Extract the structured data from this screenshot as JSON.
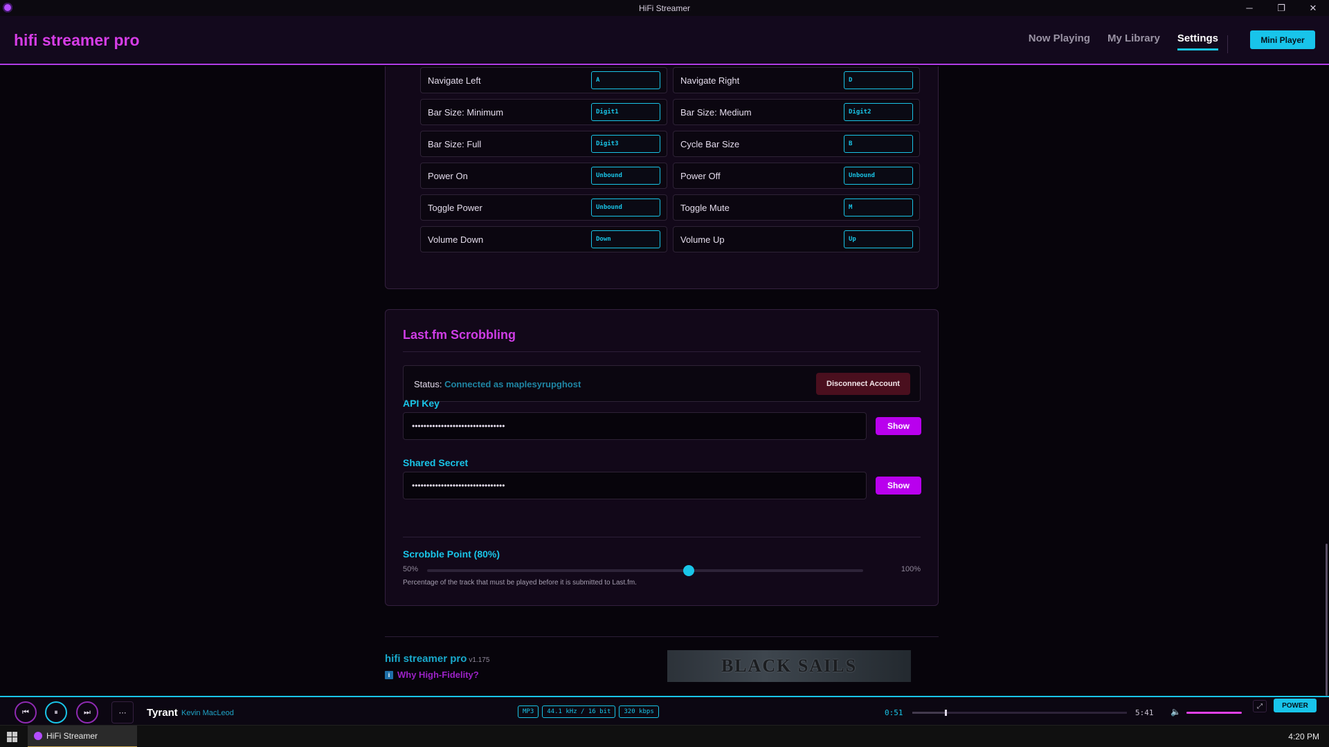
{
  "window": {
    "title": "HiFi Streamer",
    "controls": [
      "─",
      "❐",
      "✕"
    ]
  },
  "header": {
    "brand": "hifi streamer pro",
    "nav": [
      "Now Playing",
      "My Library",
      "Settings"
    ],
    "active_nav": "Settings",
    "mini_player": "Mini Player"
  },
  "keybindings": [
    {
      "label": "Navigate Left",
      "key": "A"
    },
    {
      "label": "Navigate Right",
      "key": "D"
    },
    {
      "label": "Bar Size: Minimum",
      "key": "Digit1"
    },
    {
      "label": "Bar Size: Medium",
      "key": "Digit2"
    },
    {
      "label": "Bar Size: Full",
      "key": "Digit3"
    },
    {
      "label": "Cycle Bar Size",
      "key": "B"
    },
    {
      "label": "Power On",
      "key": "Unbound"
    },
    {
      "label": "Power Off",
      "key": "Unbound"
    },
    {
      "label": "Toggle Power",
      "key": "Unbound"
    },
    {
      "label": "Toggle Mute",
      "key": "M"
    },
    {
      "label": "Volume Down",
      "key": "Down"
    },
    {
      "label": "Volume Up",
      "key": "Up"
    }
  ],
  "lastfm": {
    "title": "Last.fm Scrobbling",
    "status_label": "Status:",
    "status_value": "Connected as maplesyrupghost",
    "disconnect": "Disconnect Account",
    "api_key_label": "API Key",
    "api_key_value": "••••••••••••••••••••••••••••••••",
    "shared_secret_label": "Shared Secret",
    "shared_secret_value": "••••••••••••••••••••••••••••••••",
    "show": "Show",
    "scrobble_label": "Scrobble Point (80%)",
    "scrobble_min": "50%",
    "scrobble_max": "100%",
    "scrobble_percent": 80,
    "hint": "Percentage of the track that must be played before it is submitted to Last.fm."
  },
  "footer": {
    "brand": "hifi streamer pro",
    "version": "v1.175",
    "link": "Why High-Fidelity?",
    "banner_text": "BLACK SAILS"
  },
  "player": {
    "title": "Tyrant",
    "artist": "Kevin MacLeod",
    "badges": [
      "MP3",
      "44.1 kHz / 16 bit",
      "320 kbps"
    ],
    "elapsed": "0:51",
    "total": "5:41",
    "progress_fraction": 0.15,
    "volume_fraction": 1.0,
    "power": "POWER",
    "buttons": {
      "prev": "⏮",
      "pause": "⏸",
      "next": "⏭",
      "menu": "⋯"
    }
  },
  "taskbar": {
    "app": "HiFi Streamer",
    "clock": "4:20 PM"
  },
  "colors": {
    "accent_cyan": "#19c5e8",
    "accent_magenta": "#d63de6",
    "accent_purple": "#b900ee",
    "background": "#07040b"
  }
}
